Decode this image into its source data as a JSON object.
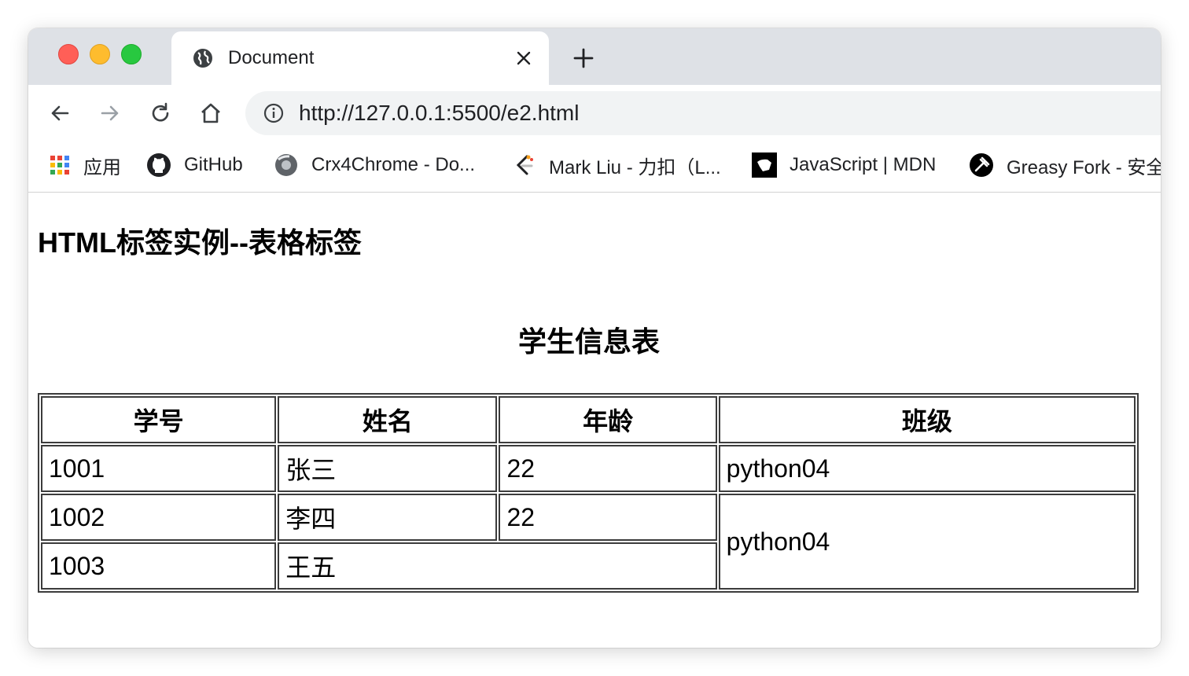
{
  "tab": {
    "title": "Document",
    "icon": "globe-icon"
  },
  "toolbar": {
    "url": "http://127.0.0.1:5500/e2.html"
  },
  "bookmarks": [
    {
      "label": "应用",
      "icon": "apps-grid-icon"
    },
    {
      "label": "GitHub",
      "icon": "github-icon"
    },
    {
      "label": "Crx4Chrome - Do...",
      "icon": "crx4chrome-icon"
    },
    {
      "label": "Mark Liu - 力扣（L...",
      "icon": "leetcode-icon"
    },
    {
      "label": "JavaScript | MDN",
      "icon": "mdn-icon"
    },
    {
      "label": "Greasy Fork - 安全",
      "icon": "greasyfork-icon"
    }
  ],
  "page": {
    "heading": "HTML标签实例--表格标签",
    "table": {
      "caption": "学生信息表",
      "headers": [
        "学号",
        "姓名",
        "年龄",
        "班级"
      ],
      "rows": [
        [
          "1001",
          "张三",
          "22",
          "python04"
        ],
        [
          "1002",
          "李四",
          "22",
          "python04"
        ],
        [
          "1003",
          "王五"
        ]
      ]
    }
  },
  "colors": {
    "tabstrip": "#dee1e6",
    "omnibox": "#f1f3f4",
    "close_red": "#ff5f57",
    "minimize_yellow": "#febc2e",
    "maximize_green": "#28c840"
  }
}
